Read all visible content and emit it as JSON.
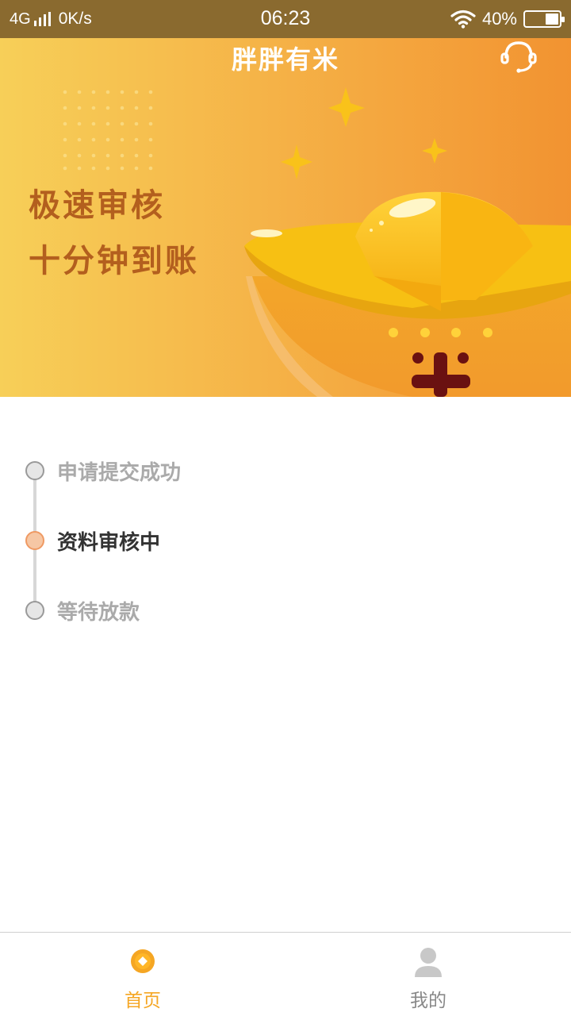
{
  "status_bar": {
    "network": "4G",
    "speed": "0K/s",
    "time": "06:23",
    "battery": "40%",
    "battery_level": 0.4
  },
  "header": {
    "title": "胖胖有米",
    "support_icon": "headset-icon"
  },
  "banner": {
    "line1": "极速审核",
    "line2": "十分钟到账",
    "colors": {
      "gradient_start": "#f7cf58",
      "gradient_end": "#f29331",
      "slogan": "#b35f1e"
    }
  },
  "progress": {
    "steps": [
      {
        "label": "申请提交成功",
        "state": "done"
      },
      {
        "label": "资料审核中",
        "state": "active"
      },
      {
        "label": "等待放款",
        "state": "pending"
      }
    ]
  },
  "tabbar": {
    "tabs": [
      {
        "label": "首页",
        "icon": "home-coin-icon",
        "active": true
      },
      {
        "label": "我的",
        "icon": "user-icon",
        "active": false
      }
    ],
    "colors": {
      "active": "#f5a623",
      "inactive": "#888888"
    }
  }
}
